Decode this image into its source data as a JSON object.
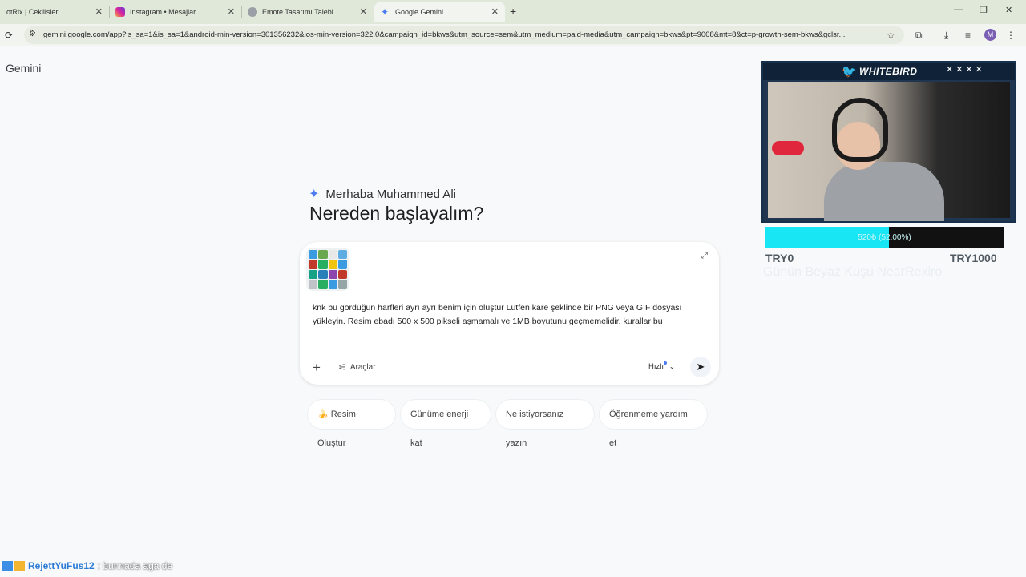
{
  "browser": {
    "tabs": [
      {
        "title": "otRix | Cekilisler",
        "active": false
      },
      {
        "title": "Instagram • Mesajlar",
        "active": false
      },
      {
        "title": "Emote Tasarımı Talebi",
        "active": false
      },
      {
        "title": "Google Gemini",
        "active": true
      }
    ],
    "new_tab": "+",
    "url": "gemini.google.com/app?is_sa=1&is_sa=1&android-min-version=301356232&ios-min-version=322.0&campaign_id=bkws&utm_source=sem&utm_medium=paid-media&utm_campaign=bkws&pt=9008&mt=8&ct=p-growth-sem-bkws&gclsr...",
    "profile_initial": "M"
  },
  "gemini": {
    "brand": "Gemini",
    "greeting": "Merhaba Muhammed Ali",
    "headline": "Nereden başlayalım?",
    "prompt_text": "knk bu gördüğün harfleri ayrı ayrı benim için oluştur  Lütfen kare şeklinde bir PNG veya GIF dosyası yükleyin. Resim ebadı 500 x 500 pikseli aşmamalı ve 1MB boyutunu geçmemelidir. kurallar bu",
    "tools_label": "Araçlar",
    "mode_label": "Hızlı",
    "chips": [
      {
        "label": "Resim Oluştur",
        "icon": "🍌"
      },
      {
        "label": "Günüme enerji kat"
      },
      {
        "label": "Ne istiyorsanız yazın"
      },
      {
        "label": "Öğrenmeme yardım et"
      }
    ]
  },
  "stream": {
    "brand": "WHITEBIRD",
    "goal_text": "520₺ (52.00%)",
    "goal_fraction": 0.52,
    "goal_min": "TRY0",
    "goal_max": "TRY1000",
    "caption": "Günün Beyaz Kuşu NearRexiro",
    "chat_user": "RejettYuFus12",
    "chat_message": ": bunnada aga de"
  },
  "colors": {
    "accent": "#4b7bf0",
    "goal_fill": "#19e6f4"
  }
}
